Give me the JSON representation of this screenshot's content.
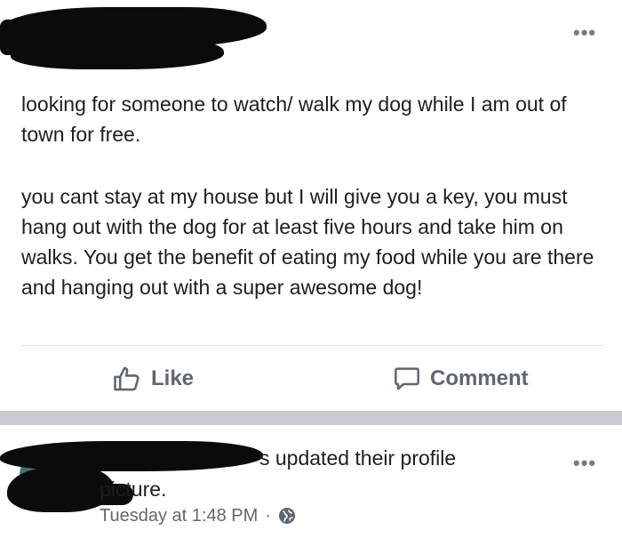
{
  "post1": {
    "paragraphs": [
      "looking for someone to watch/ walk my dog while I am out of town for free.",
      "you cant stay at my house but I will give you a key, you must hang out with the dog for at least five hours and take him on walks. You get the benefit of eating my food while you are there and hanging out with a super awesome dog!"
    ],
    "actions": {
      "like": "Like",
      "comment": "Comment"
    },
    "more_menu": "•••"
  },
  "post2": {
    "title_suffix": "s updated their profile",
    "subtitle": "picture.",
    "time": "Tuesday at 1:48 PM",
    "separator": "·",
    "more_menu": "•••"
  },
  "icons": {
    "like": "thumbs-up-icon",
    "comment": "speech-bubble-icon",
    "privacy": "globe-icon"
  },
  "colors": {
    "text": "#1c1e21",
    "muted": "#606770",
    "band": "#c9ccd1",
    "redaction": "#0b0b0b"
  }
}
